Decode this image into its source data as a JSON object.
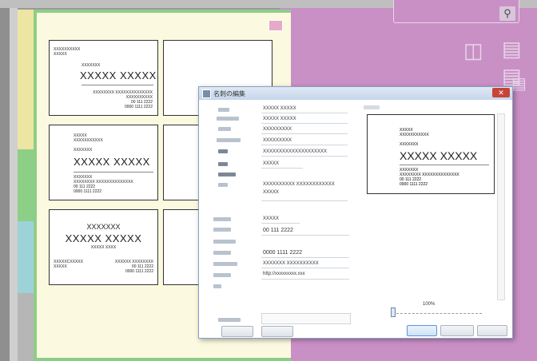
{
  "app": {
    "search_icon": "magnifier-icon",
    "side_icons": [
      "book-icon",
      "document-icon",
      "book-icon-2",
      "document-icon-2"
    ]
  },
  "cards": [
    {
      "small_top": "XXXXXXXXXX\nXXXXX",
      "title": "XXXXXXX",
      "name": "XXXXX XXXXX",
      "addr": "XXXXXXXX XXXXXXXXXXXXXX\nXXXXXXXXXX\n00 111 2222\n0000 1111 2222"
    },
    {
      "small_top": "XXXXX\nXXXXXXXXXXX",
      "title": "XXXXXXX",
      "name": "XXXXX XXXXX",
      "addr": "XXXXXXX\nXXXXXXXX XXXXXXXXXXXXXX\n00 111 2222\n0000 1111 2222"
    },
    {
      "small_top": "",
      "title": "XXXXXXX",
      "name": "XXXXX XXXXX",
      "addr_sub": "XXXXX XXXX",
      "addr_left": "XXXXXCXXXXX\nXXXXX",
      "addr_right": "XXXXXX XXXXXXXX\n00 111 2222\n0000 1111 2222"
    }
  ],
  "dialog": {
    "title": "名刺の編集",
    "close_label": "✕",
    "fields": [
      "XXXXX XXXXX",
      "XXXXX XXXXX",
      "XXXXXXXXX",
      "XXXXXXXXX",
      "XXXXXXXXXXXXXXXXXXXX",
      "XXXXX",
      "XXXXXXXXXX XXXXXXXXXXXX",
      "XXXXX",
      "XXXXX",
      "00 111 2222",
      "0000 1111 2222",
      "XXXXXXX XXXXXXXXXX",
      "http://xxxxxxxxx.xxx"
    ],
    "preview": {
      "top": "XXXXX\nXXXXXXXXXXX",
      "title": "XXXXXXX",
      "name": "XXXXX XXXXX",
      "addr": "XXXXXXX\nXXXXXXXX XXXXXXXXXXXXXX\n00 111 2222\n0000 1111 2222"
    },
    "zoom_label": "100%"
  }
}
